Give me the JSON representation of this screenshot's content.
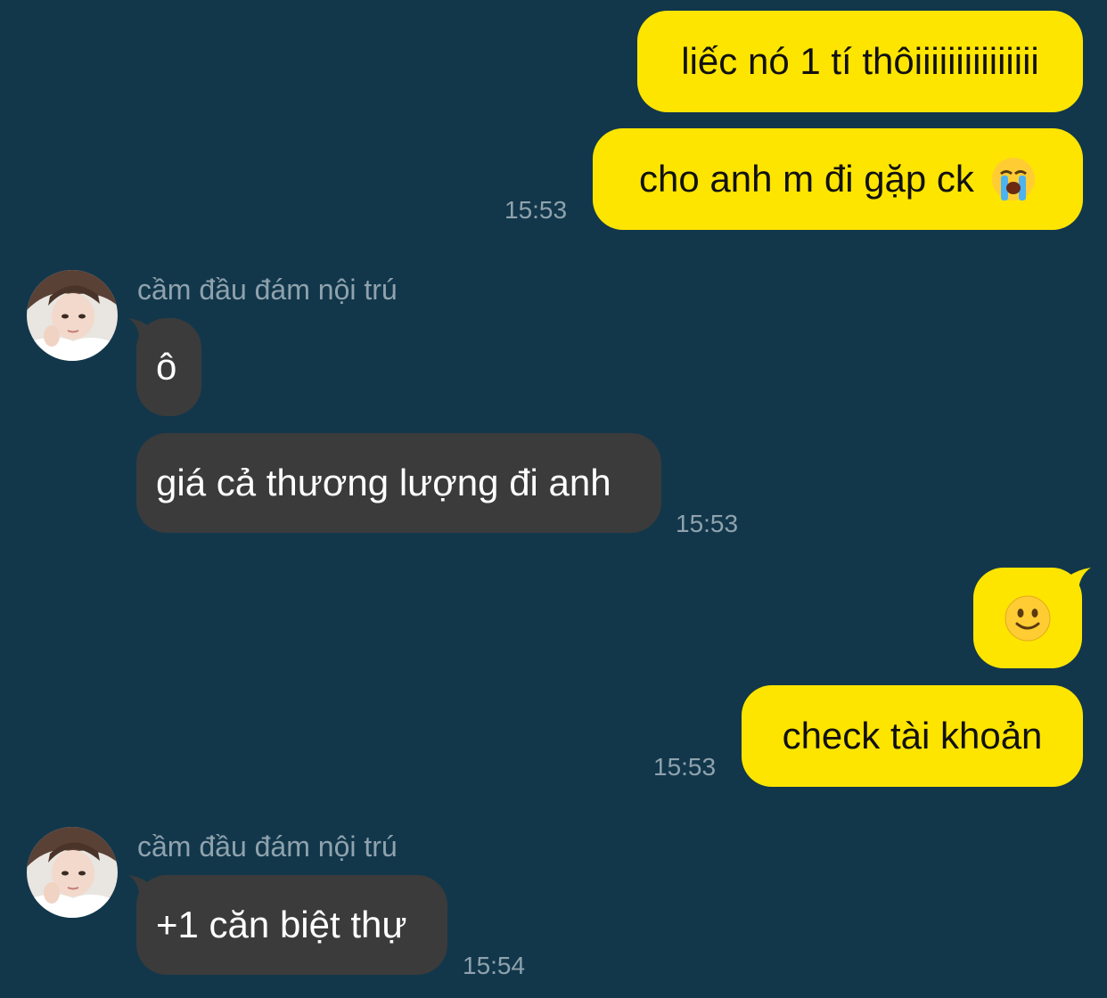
{
  "colors": {
    "background": "#12374b",
    "outgoing_bubble": "#fee500",
    "incoming_bubble": "#3b3b3b",
    "timestamp": "#8fa2ad"
  },
  "messages": {
    "m1": {
      "text": "liếc nó 1 tí thôiiiiiiiiiiiiiii"
    },
    "m2": {
      "text": "cho anh m đi gặp ck",
      "emoji": "😭",
      "emoji_name": "loudly-crying-face-emoji",
      "time": "15:53"
    },
    "g1": {
      "sender": "cầm đầu đám nội trú",
      "avatar_icon": "avatar-photo"
    },
    "m3": {
      "text": "ô"
    },
    "m4": {
      "text": "giá cả thương lượng đi anh",
      "time": "15:53"
    },
    "m5": {
      "emoji": "🙂",
      "emoji_name": "slightly-smiling-face-emoji"
    },
    "m6": {
      "text": "check tài khoản",
      "time": "15:53"
    },
    "g2": {
      "sender": "cầm đầu đám nội trú",
      "avatar_icon": "avatar-photo"
    },
    "m7": {
      "text": "+1 căn biệt thự",
      "time": "15:54"
    }
  }
}
